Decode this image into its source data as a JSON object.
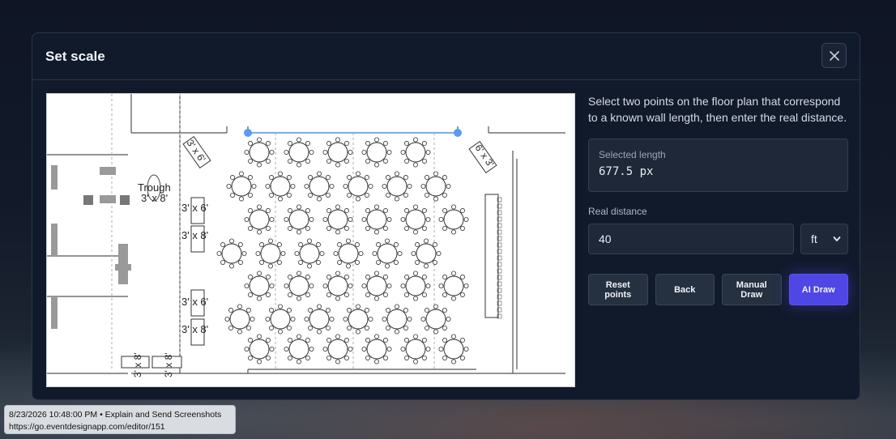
{
  "modal": {
    "title": "Set scale",
    "close_icon": "close-icon"
  },
  "floor_plan": {
    "labels": {
      "trough": "Trough",
      "trough_size": "3' x 8'",
      "table_3x6": "3' x 6'",
      "table_3x8": "3' x 8'",
      "table_6x3": "6' x 3'"
    },
    "accent_color": "#5b9bf0"
  },
  "side": {
    "instructions": "Select two points on the floor plan that correspond to a known wall length, then enter the real distance.",
    "selected_length_label": "Selected length",
    "selected_length_value": "677.5 px",
    "real_distance_label": "Real distance",
    "real_distance_value": "40",
    "unit_selected": "ft"
  },
  "buttons": {
    "reset": "Reset\npoints",
    "back": "Back",
    "manual": "Manual\nDraw",
    "ai": "AI Draw",
    "ai_color": "#4f46e5"
  },
  "tooltip": {
    "line1": "8/23/2026 10:48:00 PM • Explain and Send Screenshots",
    "line2": "https://go.eventdesignapp.com/editor/151"
  }
}
